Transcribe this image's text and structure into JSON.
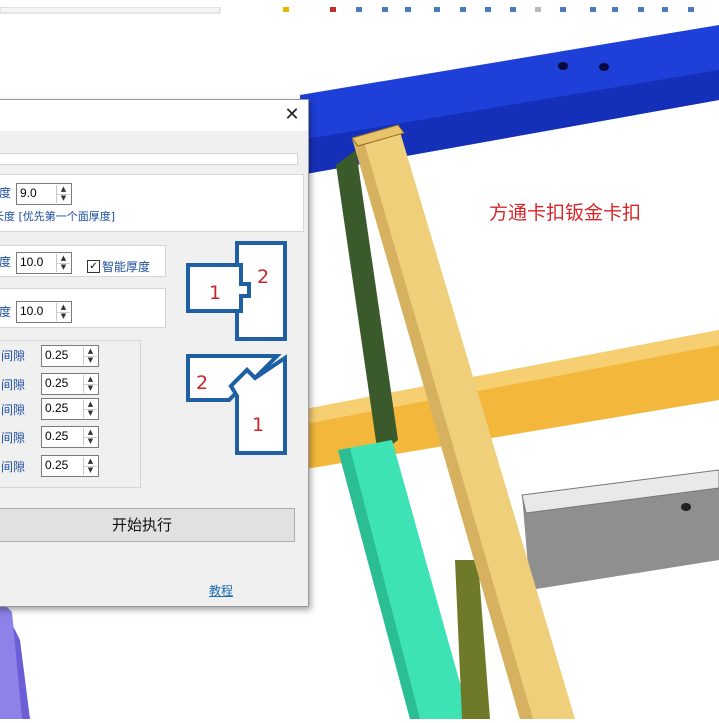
{
  "scene": {
    "annotation": "方通卡扣钣金卡扣",
    "colors": {
      "blue_beam": "#1e3fd8",
      "tan_beam": "#f0cf7a",
      "dark_green_beam": "#3b5a2b",
      "aqua_beam": "#3de3b5",
      "orange_beam": "#f3b73c",
      "grey_beam": "#9c9c9c"
    }
  },
  "dialog": {
    "close_glyph": "✕",
    "row1": {
      "label_tail": "度",
      "value": "9.0",
      "note": "长度 [优先第一个面厚度]"
    },
    "row2": {
      "label_tail": "度",
      "value": "10.0",
      "smart_check": "✓",
      "smart_label": "智能厚度"
    },
    "row3": {
      "label_tail": "度",
      "value": "10.0"
    },
    "gaps": [
      {
        "label": "间隙",
        "value": "0.25"
      },
      {
        "label": "间隙",
        "value": "0.25"
      },
      {
        "label": "间隙",
        "value": "0.25"
      },
      {
        "label": "间隙",
        "value": "0.25"
      },
      {
        "label": "间隙",
        "value": "0.25"
      }
    ],
    "diagram_top": {
      "left_num": "1",
      "right_num": "2"
    },
    "diagram_bottom": {
      "left_num": "2",
      "right_num": "1"
    },
    "tutorial_link": "教程",
    "execute_button": "开始执行"
  }
}
